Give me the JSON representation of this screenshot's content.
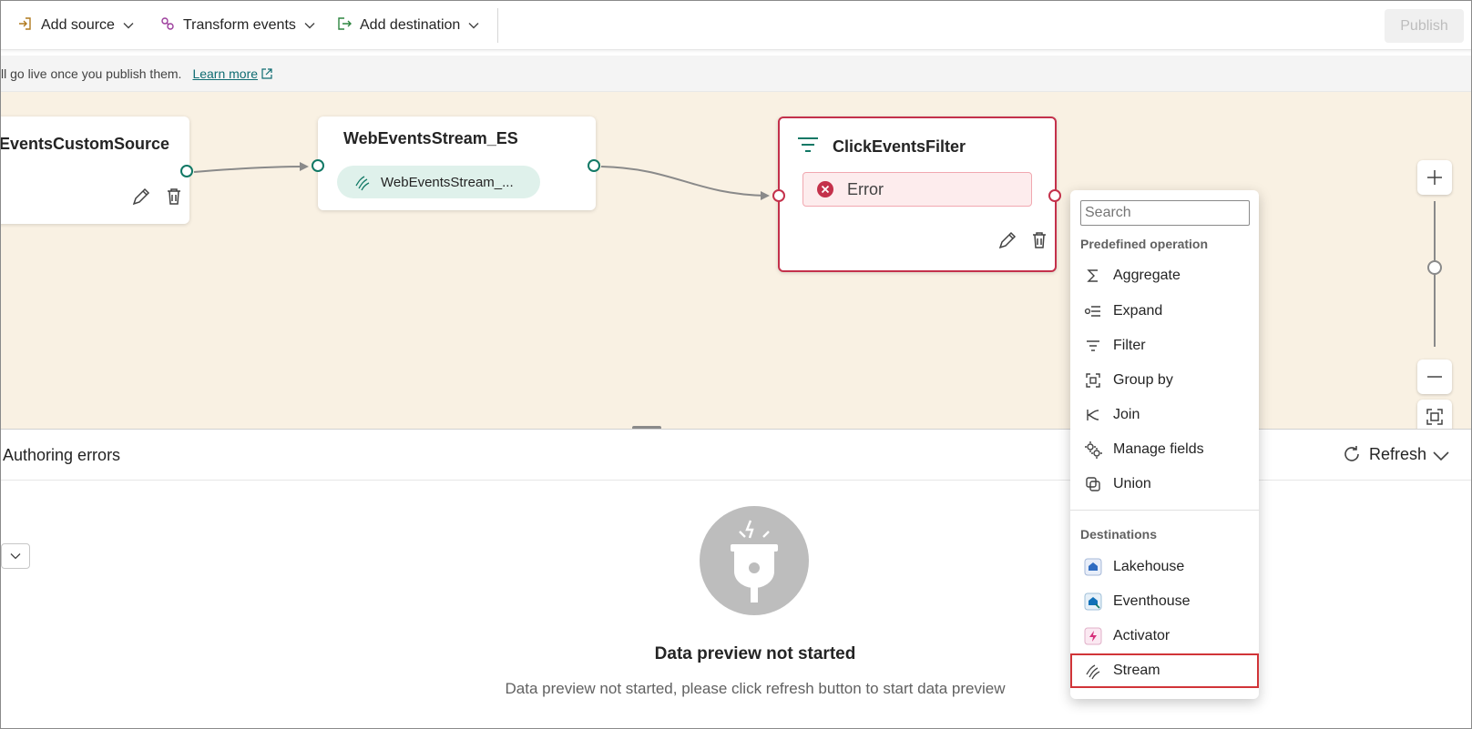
{
  "toolbar": {
    "add_source": "Add source",
    "transform_events": "Transform events",
    "add_destination": "Add destination",
    "publish": "Publish"
  },
  "infobar": {
    "message": "ll go live once you publish them.",
    "learn_more": "Learn more"
  },
  "canvas": {
    "nodes": {
      "source": {
        "title": "EventsCustomSource"
      },
      "stream": {
        "title": "WebEventsStream_ES",
        "pill": "WebEventsStream_..."
      },
      "filter": {
        "title": "ClickEventsFilter",
        "status": "Error"
      }
    }
  },
  "menu": {
    "search_placeholder": "Search",
    "section_predefined": "Predefined operation",
    "operations": [
      "Aggregate",
      "Expand",
      "Filter",
      "Group by",
      "Join",
      "Manage fields",
      "Union"
    ],
    "section_destinations": "Destinations",
    "destinations": [
      "Lakehouse",
      "Eventhouse",
      "Activator",
      "Stream"
    ]
  },
  "panel": {
    "title": "Authoring errors",
    "refresh": "Refresh",
    "empty_title": "Data preview not started",
    "empty_subtitle": "Data preview not started, please click refresh button to start data preview"
  },
  "colors": {
    "accent_teal": "#117865",
    "error_red": "#c4314b",
    "canvas_bg": "#f9f1e3",
    "highlight_border": "#d13438"
  }
}
